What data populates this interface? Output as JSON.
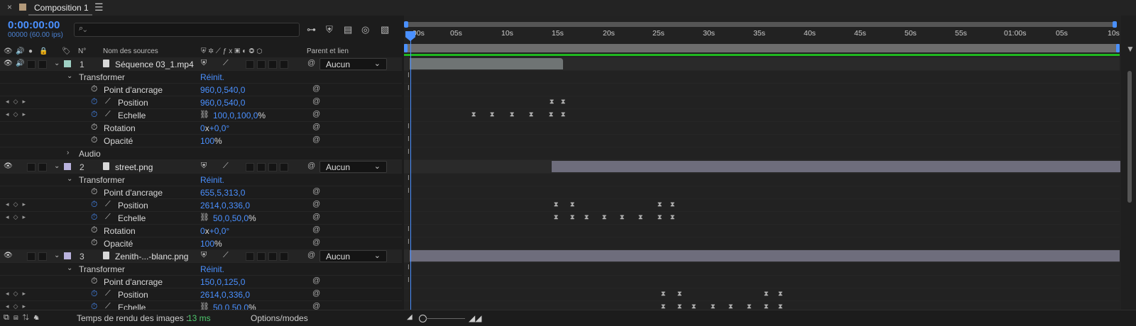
{
  "tab": {
    "close": "×",
    "title": "Composition 1",
    "menu": "☰"
  },
  "timecode": "0:00:00:00",
  "fps": "00000 (60.00 ips)",
  "search": {
    "icon": "search-icon",
    "glyph": "⌕⌄"
  },
  "columns": {
    "number": "N°",
    "source_name": "Nom des sources",
    "parent": "Parent et lien"
  },
  "ruler": {
    "ticks": [
      ":00s",
      "05s",
      "10s",
      "15s",
      "20s",
      "25s",
      "30s",
      "35s",
      "40s",
      "45s",
      "50s",
      "55s",
      "01:00s",
      "05s",
      "10s"
    ]
  },
  "layers": [
    {
      "num": "1",
      "name": "Séquence 03_1.mp4",
      "label_color": "#9fd0c4",
      "parent": "Aucun",
      "groups": [
        {
          "name": "Transformer",
          "reset": "Réinit.",
          "expanded": true,
          "props": [
            {
              "name": "Point d'ancrage",
              "value": "960,0,540,0",
              "animated": false
            },
            {
              "name": "Position",
              "value": "960,0,540,0",
              "animated": true
            },
            {
              "name": "Echelle",
              "value": "100,0,100,0",
              "unit": "%",
              "linked": true,
              "animated": true
            },
            {
              "name": "Rotation",
              "value": "0",
              "value2": "+0,0°",
              "animated": false
            },
            {
              "name": "Opacité",
              "value": "100",
              "unit": "%",
              "animated": false
            }
          ]
        },
        {
          "name": "Audio",
          "expanded": false
        }
      ]
    },
    {
      "num": "2",
      "name": "street.png",
      "label_color": "#b9b2dd",
      "parent": "Aucun",
      "groups": [
        {
          "name": "Transformer",
          "reset": "Réinit.",
          "expanded": true,
          "props": [
            {
              "name": "Point d'ancrage",
              "value": "655,5,313,0",
              "animated": false
            },
            {
              "name": "Position",
              "value": "2614,0,336,0",
              "animated": true
            },
            {
              "name": "Echelle",
              "value": "50,0,50,0",
              "unit": "%",
              "linked": true,
              "animated": true
            },
            {
              "name": "Rotation",
              "value": "0",
              "value2": "+0,0°",
              "animated": false
            },
            {
              "name": "Opacité",
              "value": "100",
              "unit": "%",
              "animated": false
            }
          ]
        }
      ]
    },
    {
      "num": "3",
      "name": "Zenith-...-blanc.png",
      "label_color": "#b9b2dd",
      "parent": "Aucun",
      "groups": [
        {
          "name": "Transformer",
          "reset": "Réinit.",
          "expanded": true,
          "props": [
            {
              "name": "Point d'ancrage",
              "value": "150,0,125,0",
              "animated": false
            },
            {
              "name": "Position",
              "value": "2614,0,336,0",
              "animated": true
            },
            {
              "name": "Echelle",
              "value": "50,0,50,0",
              "unit": "%",
              "linked": true,
              "animated": true
            }
          ]
        }
      ]
    }
  ],
  "status": {
    "render_label": "Temps de rendu des images :",
    "render_value": "13 ms",
    "options": "Options/modes"
  },
  "colors": {
    "accent": "#4a90ff",
    "green": "#1fb81f"
  }
}
